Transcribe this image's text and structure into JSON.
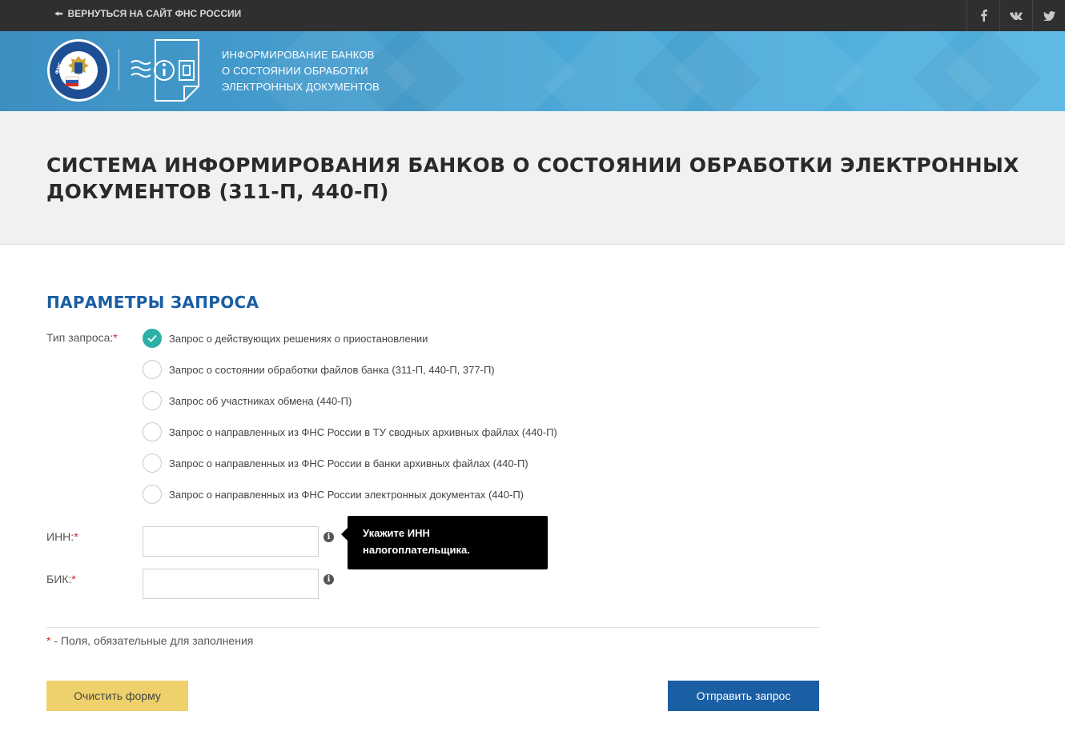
{
  "topbar": {
    "back_link": "ВЕРНУТЬСЯ НА САЙТ ФНС РОССИИ",
    "social": [
      {
        "icon": "facebook-icon",
        "label": "f"
      },
      {
        "icon": "vk-icon",
        "label": "vk"
      },
      {
        "icon": "twitter-icon",
        "label": "twitter"
      }
    ]
  },
  "banner": {
    "lines": [
      "ИНФОРМИРОВАНИЕ БАНКОВ",
      "О СОСТОЯНИИ ОБРАБОТКИ",
      "ЭЛЕКТРОННЫХ ДОКУМЕНТОВ"
    ],
    "emblem_ring_text": "ФЕДЕРАЛЬНАЯ НАЛОГОВАЯ СЛУЖБА"
  },
  "page": {
    "title": "СИСТЕМА ИНФОРМИРОВАНИЯ БАНКОВ О СОСТОЯНИИ ОБРАБОТКИ ЭЛЕКТРОННЫХ ДОКУМЕНТОВ (311-П, 440-П)"
  },
  "form": {
    "section_title": "ПАРАМЕТРЫ ЗАПРОСА",
    "request_type_label": "Тип запроса:",
    "required_mark": "*",
    "request_types": [
      {
        "label": "Запрос о действующих решениях о приостановлении",
        "checked": true
      },
      {
        "label": "Запрос о состоянии обработки файлов банка (311-П, 440-П, 377-П)",
        "checked": false
      },
      {
        "label": "Запрос об участниках обмена (440-П)",
        "checked": false
      },
      {
        "label": "Запрос о направленных из ФНС России в ТУ сводных архивных файлах (440-П)",
        "checked": false
      },
      {
        "label": "Запрос о направленных из ФНС России в банки архивных файлах (440-П)",
        "checked": false
      },
      {
        "label": "Запрос о направленных из ФНС России электронных документах (440-П)",
        "checked": false
      }
    ],
    "inn": {
      "label": "ИНН:",
      "value": "",
      "placeholder": ""
    },
    "bik": {
      "label": "БИК:",
      "value": "",
      "placeholder": ""
    },
    "info_icon_glyph": "i",
    "tooltip": {
      "line1": "Укажите ИНН",
      "line2": "налогоплательщика."
    },
    "required_note": " - Поля, обязательные для заполнения",
    "clear_button": "Очистить форму",
    "submit_button": "Отправить запрос"
  },
  "colors": {
    "topbar": "#2f2f2f",
    "banner": "#4aa6d6",
    "accent_blue": "#1a5ea3",
    "radio_checked": "#2bb1a8",
    "clear_button": "#efd16b",
    "required": "#d0232b"
  }
}
